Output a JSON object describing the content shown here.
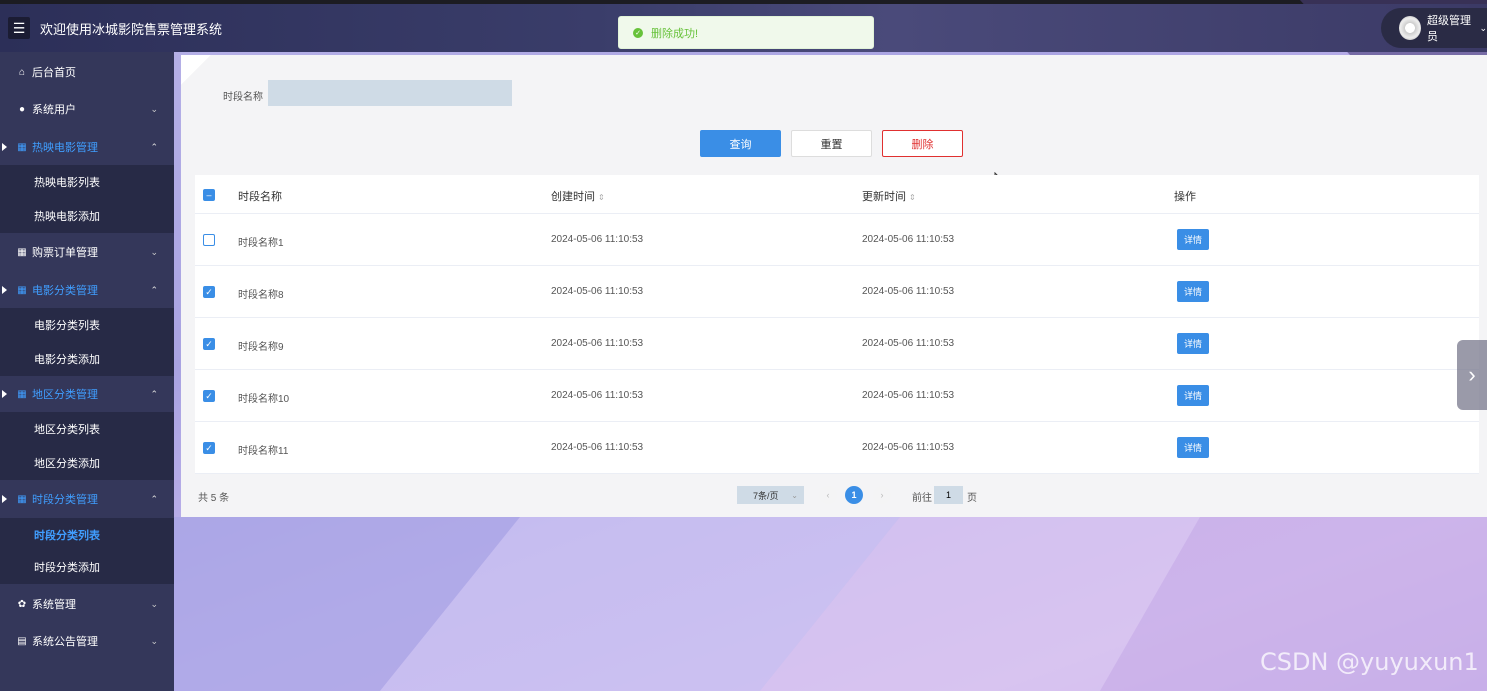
{
  "header": {
    "menu_icon": "menu-icon",
    "title": "欢迎使用冰城影院售票管理系统",
    "user_name": "超级管理员"
  },
  "toast": {
    "message": "删除成功!",
    "color": "#67c23a"
  },
  "sidebar": {
    "items": [
      {
        "label": "后台首页",
        "icon": "home-icon"
      },
      {
        "label": "系统用户",
        "icon": "user-icon"
      },
      {
        "label": "热映电影管理",
        "icon": "grid-icon"
      },
      {
        "label": "热映电影列表"
      },
      {
        "label": "热映电影添加"
      },
      {
        "label": "购票订单管理",
        "icon": "grid-icon"
      },
      {
        "label": "电影分类管理",
        "icon": "grid-icon"
      },
      {
        "label": "电影分类列表"
      },
      {
        "label": "电影分类添加"
      },
      {
        "label": "地区分类管理",
        "icon": "grid-icon"
      },
      {
        "label": "地区分类列表"
      },
      {
        "label": "地区分类添加"
      },
      {
        "label": "时段分类管理",
        "icon": "grid-icon"
      },
      {
        "label": "时段分类列表"
      },
      {
        "label": "时段分类添加"
      },
      {
        "label": "系统管理",
        "icon": "gear-icon"
      },
      {
        "label": "系统公告管理",
        "icon": "notice-icon"
      }
    ]
  },
  "filter": {
    "label": "时段名称",
    "value": ""
  },
  "buttons": {
    "query": "查询",
    "reset": "重置",
    "delete": "删除"
  },
  "table": {
    "headers": [
      "时段名称",
      "创建时间",
      "更新时间",
      "操作"
    ],
    "detail_label": "详情",
    "rows": [
      {
        "name": "时段名称1",
        "created": "2024-05-06 11:10:53",
        "updated": "2024-05-06 11:10:53",
        "checked": false
      },
      {
        "name": "时段名称8",
        "created": "2024-05-06 11:10:53",
        "updated": "2024-05-06 11:10:53",
        "checked": true
      },
      {
        "name": "时段名称9",
        "created": "2024-05-06 11:10:53",
        "updated": "2024-05-06 11:10:53",
        "checked": true
      },
      {
        "name": "时段名称10",
        "created": "2024-05-06 11:10:53",
        "updated": "2024-05-06 11:10:53",
        "checked": true
      },
      {
        "name": "时段名称11",
        "created": "2024-05-06 11:10:53",
        "updated": "2024-05-06 11:10:53",
        "checked": true
      }
    ]
  },
  "pagination": {
    "total": "共 5 条",
    "page_size": "7条/页",
    "current_page": "1",
    "goto_label": "前往",
    "goto_value": "1",
    "page_unit": "页"
  },
  "watermark": "CSDN @yuyuxun1",
  "colors": {
    "primary": "#3a8ee6",
    "danger": "#e03030",
    "sidebar_bg": "#34375a"
  }
}
